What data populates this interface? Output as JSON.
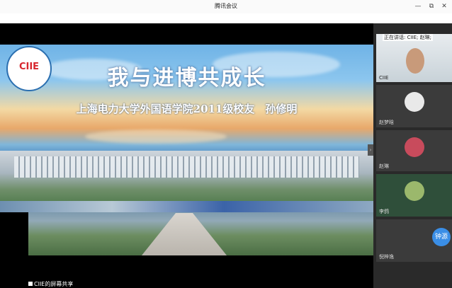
{
  "window": {
    "title": "腾讯会议",
    "buttons": [
      "—",
      "⧉",
      "✕"
    ]
  },
  "slide": {
    "title": "我与进博共成长",
    "subtitle": "上海电力大学外国语学院2011级校友　孙修明",
    "logo_text": "CIIE"
  },
  "share": {
    "label": "CIIE的屏幕共享"
  },
  "participants": {
    "speaking": "正在讲话: CIIE; 赵琳;",
    "tiles": [
      {
        "name": "CIIE"
      },
      {
        "name": "赵梦晗"
      },
      {
        "name": "赵琳"
      },
      {
        "name": "李鸽"
      },
      {
        "name": "倪梓逸"
      }
    ]
  },
  "float_button": {
    "label": "钟源"
  },
  "colors": {
    "accent": "#3a8ee6",
    "panel_bg": "#2a2a2a"
  }
}
